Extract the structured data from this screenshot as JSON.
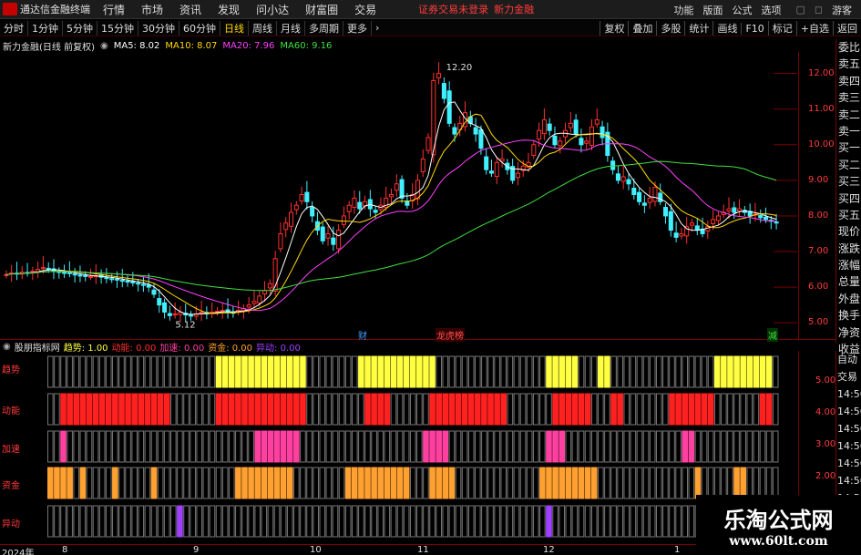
{
  "app": {
    "title": "通达信金融终端",
    "notice": "证券交易未登录",
    "stock_link": "新力金融"
  },
  "menu": [
    "行情",
    "市场",
    "资讯",
    "发现",
    "问小达",
    "财富圈",
    "交易"
  ],
  "menu_right": [
    "功能",
    "版面",
    "公式",
    "选项",
    "游客"
  ],
  "periods": [
    "分时",
    "1分钟",
    "5分钟",
    "15分钟",
    "30分钟",
    "60分钟",
    "日线",
    "周线",
    "月线",
    "多周期",
    "更多"
  ],
  "active_period": "日线",
  "tools_right": [
    "复权",
    "叠加",
    "多股",
    "统计",
    "画线",
    "F10",
    "标记",
    "+自选",
    "返回"
  ],
  "stock_label": "新力金融(日线 前复权)",
  "ma": [
    {
      "label": "MA5: 8.02",
      "color": "#ffffff"
    },
    {
      "label": "MA10: 8.07",
      "color": "#ffd800"
    },
    {
      "label": "MA20: 7.96",
      "color": "#ff40ff"
    },
    {
      "label": "MA60: 9.16",
      "color": "#40e040"
    }
  ],
  "side_panel": [
    "委比",
    "卖五",
    "卖四",
    "卖三",
    "卖二",
    "卖一",
    "买一",
    "买二",
    "买三",
    "买四",
    "买五",
    "现价",
    "涨跌",
    "涨幅",
    "总量",
    "外盘",
    "换手",
    "净资",
    "收益"
  ],
  "side_panel2": [
    "自动",
    "交易",
    "14:56",
    "14:56",
    "14:56",
    "14:56",
    "14:56",
    "14:56",
    "14:56",
    "14:56"
  ],
  "indicator": {
    "name": "股朋指标网",
    "values": [
      {
        "label": "趋势: 1.00",
        "color": "#ffff40"
      },
      {
        "label": "动能: 0.00",
        "color": "#ff3030"
      },
      {
        "label": "加速: 0.00",
        "color": "#ff40a0"
      },
      {
        "label": "资金: 0.00",
        "color": "#ffa030"
      },
      {
        "label": "异动: 0.00",
        "color": "#a040ff"
      }
    ],
    "rows": [
      "趋势",
      "动能",
      "加速",
      "资金",
      "异动"
    ],
    "yticks": [
      "5.00",
      "4.00",
      "3.00",
      "2.00"
    ]
  },
  "annotations": {
    "high": "12.20",
    "low": "5.12",
    "cai": "财",
    "lhb": "龙虎榜",
    "jian": "减"
  },
  "dates": [
    "2024年",
    "8",
    "9",
    "10",
    "11",
    "12",
    "1"
  ],
  "watermark": {
    "line1": "乐淘公式网",
    "line2": "www.60lt.com"
  },
  "chart_data": {
    "type": "candlestick",
    "ylim": [
      4.8,
      12.4
    ],
    "yticks": [
      5,
      6,
      7,
      8,
      9,
      10,
      11,
      12
    ],
    "close": [
      6.35,
      6.4,
      6.38,
      6.42,
      6.4,
      6.45,
      6.5,
      6.55,
      6.5,
      6.45,
      6.42,
      6.4,
      6.38,
      6.35,
      6.32,
      6.3,
      6.3,
      6.32,
      6.28,
      6.25,
      6.22,
      6.2,
      6.18,
      6.15,
      6.12,
      6.1,
      6.05,
      6.0,
      5.8,
      5.5,
      5.3,
      5.2,
      5.25,
      5.3,
      5.22,
      5.2,
      5.25,
      5.3,
      5.28,
      5.3,
      5.32,
      5.35,
      5.3,
      5.28,
      5.35,
      5.4,
      5.5,
      5.6,
      5.75,
      5.9,
      6.1,
      6.8,
      7.5,
      7.8,
      8.1,
      8.3,
      8.6,
      8.4,
      8.0,
      7.6,
      7.3,
      7.5,
      7.2,
      7.6,
      8.0,
      8.3,
      8.5,
      8.2,
      8.4,
      8.2,
      8.1,
      8.3,
      8.5,
      8.6,
      8.9,
      8.5,
      8.3,
      8.6,
      9.0,
      9.6,
      10.2,
      11.8,
      12.0,
      11.3,
      10.6,
      10.3,
      10.6,
      10.9,
      10.6,
      10.3,
      9.9,
      9.3,
      9.2,
      9.5,
      9.6,
      9.3,
      9.0,
      9.2,
      9.4,
      9.5,
      10.0,
      10.4,
      10.7,
      10.4,
      10.0,
      10.1,
      10.4,
      10.6,
      10.3,
      10.0,
      10.1,
      10.5,
      10.7,
      10.2,
      9.7,
      9.3,
      9.0,
      9.1,
      8.9,
      8.6,
      8.4,
      8.3,
      8.5,
      8.8,
      8.4,
      8.0,
      7.6,
      7.4,
      7.5,
      7.7,
      7.8,
      7.6,
      7.5,
      7.7,
      7.9,
      8.0,
      8.1,
      8.2,
      8.1,
      8.2,
      8.1,
      8.0,
      8.05,
      7.95,
      7.9,
      7.85,
      7.8
    ]
  }
}
